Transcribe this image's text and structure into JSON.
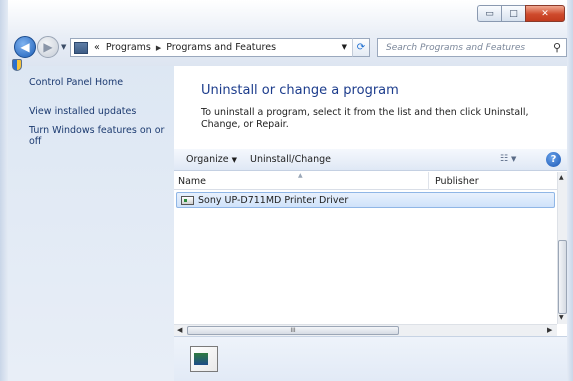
{
  "window": {
    "minimize_label": "▭",
    "maximize_label": "□",
    "close_label": "✕"
  },
  "address_bar": {
    "overflow": "«",
    "crumbs": [
      "Programs",
      "Programs and Features"
    ]
  },
  "search": {
    "placeholder": "Search Programs and Features"
  },
  "left_pane": {
    "control_panel_home": "Control Panel Home",
    "view_installed_updates": "View installed updates",
    "turn_windows_features": "Turn Windows features on or off"
  },
  "main": {
    "heading": "Uninstall or change a program",
    "description": "To uninstall a program, select it from the list and then click Uninstall, Change, or Repair."
  },
  "toolbar": {
    "organize": "Organize",
    "uninstall_change": "Uninstall/Change"
  },
  "list": {
    "columns": [
      "Name",
      "Publisher"
    ],
    "rows": [
      {
        "name": "Sony UP-D711MD Printer Driver",
        "publisher": ""
      }
    ]
  },
  "scrollbar": {
    "grip": "III"
  }
}
